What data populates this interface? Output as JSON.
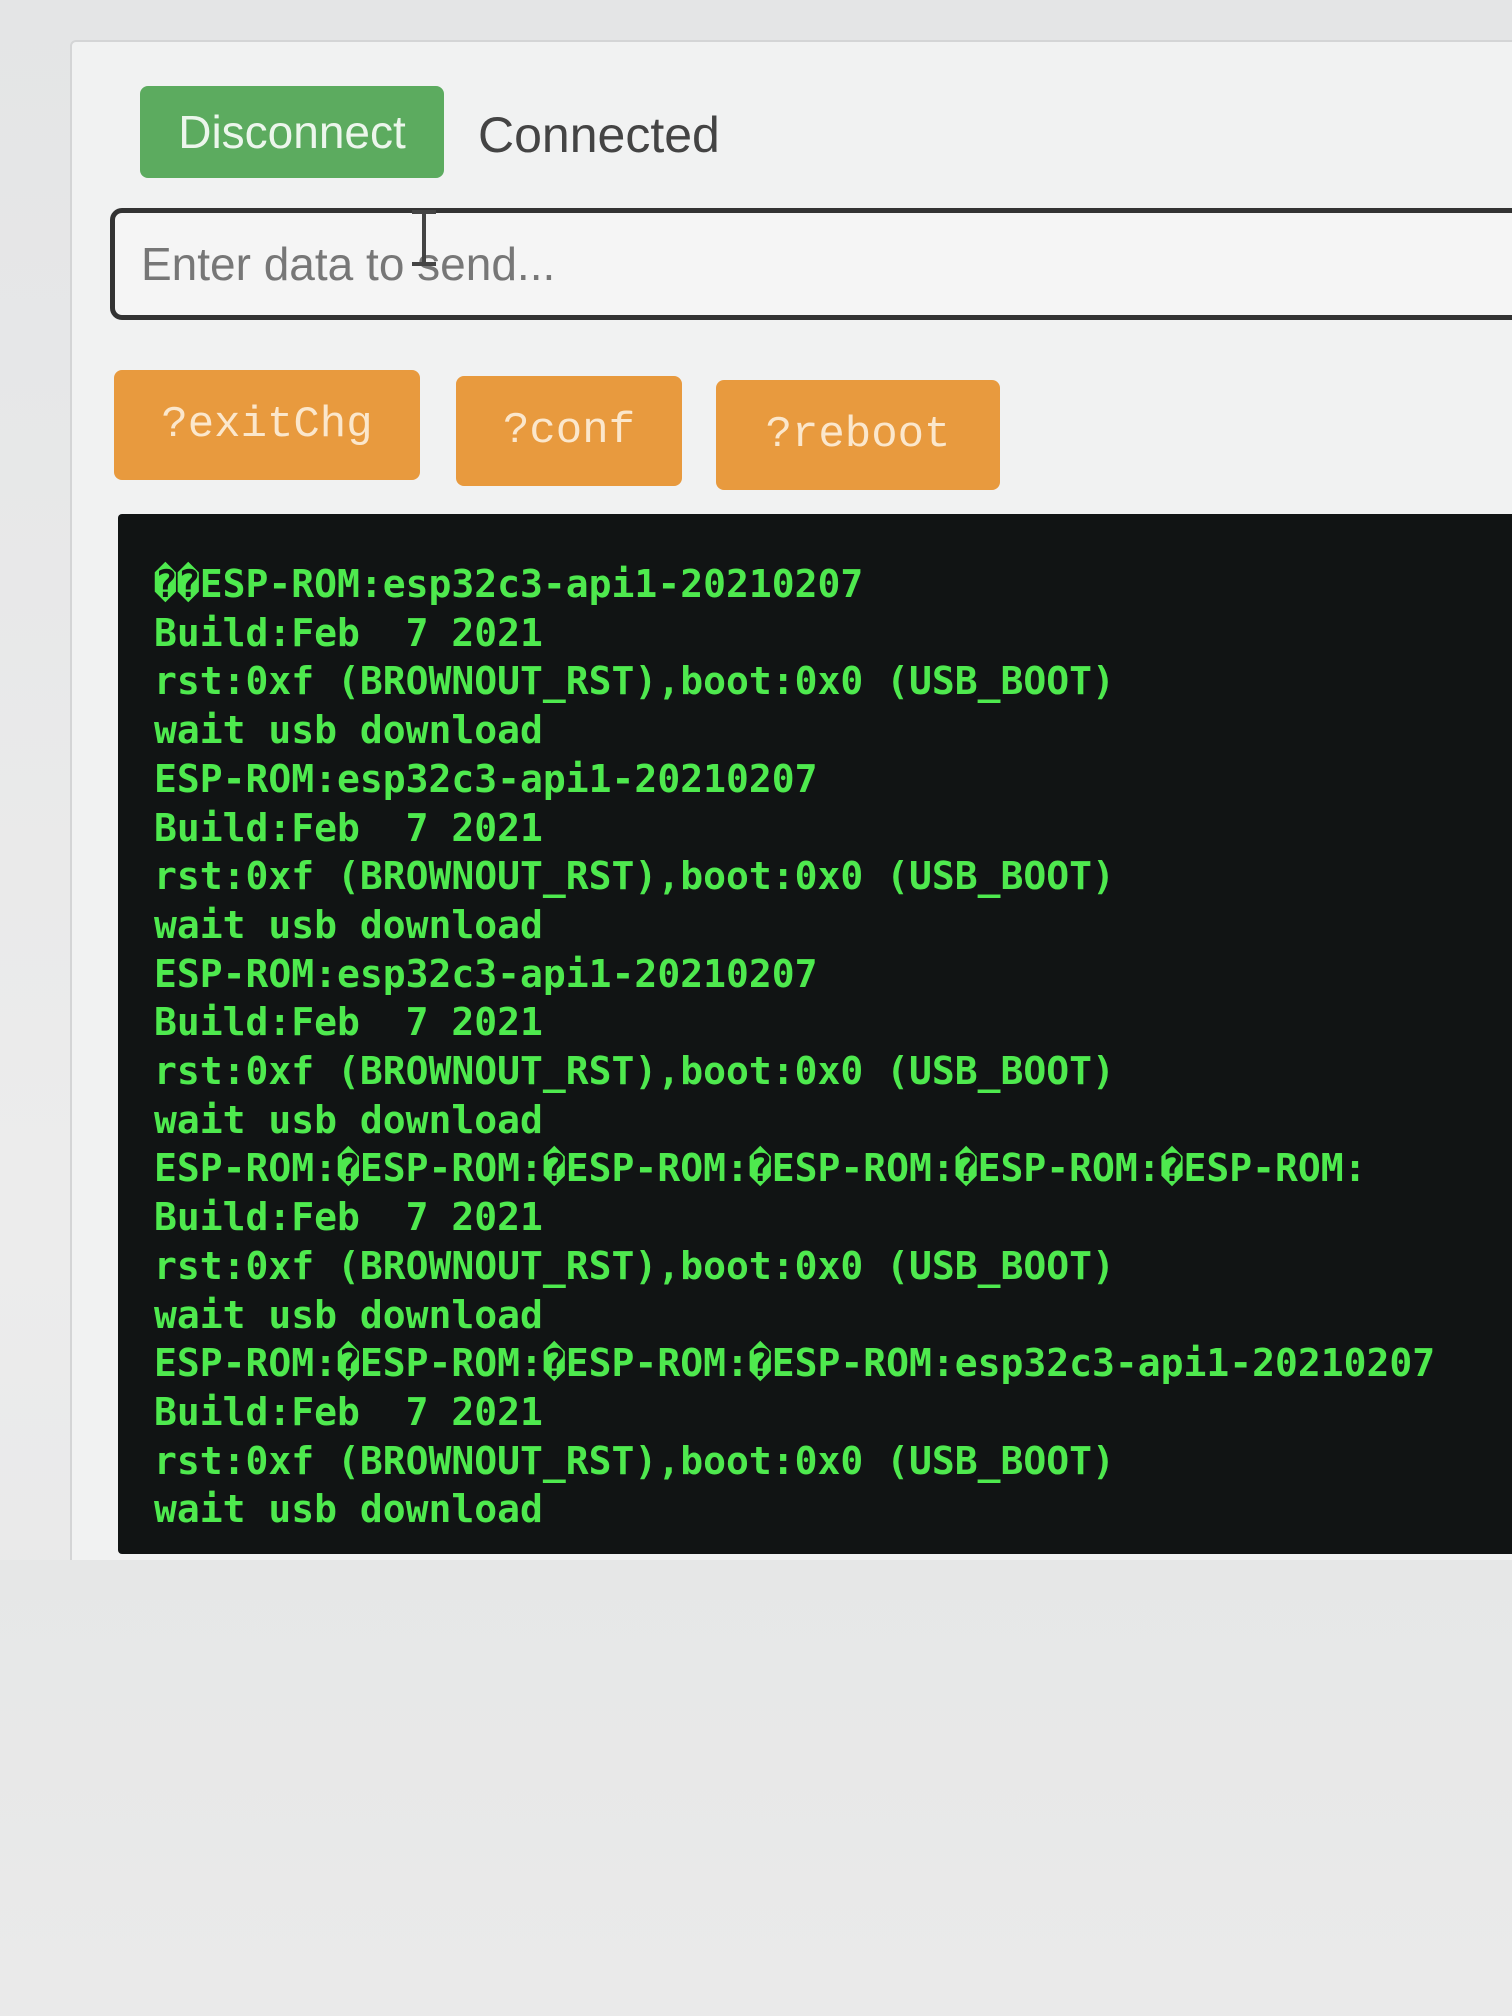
{
  "controls": {
    "disconnect_label": "Disconnect",
    "status": "Connected",
    "send_placeholder": "Enter data to send...",
    "send_value": ""
  },
  "commands": [
    {
      "label": "?exitChg"
    },
    {
      "label": "?conf"
    },
    {
      "label": "?reboot"
    }
  ],
  "console": {
    "text_color": "#4ee94e",
    "background": "#111414",
    "lines": [
      "��ESP-ROM:esp32c3-api1-20210207",
      "Build:Feb  7 2021",
      "rst:0xf (BROWNOUT_RST),boot:0x0 (USB_BOOT)",
      "wait usb download",
      "ESP-ROM:esp32c3-api1-20210207",
      "Build:Feb  7 2021",
      "rst:0xf (BROWNOUT_RST),boot:0x0 (USB_BOOT)",
      "wait usb download",
      "ESP-ROM:esp32c3-api1-20210207",
      "Build:Feb  7 2021",
      "rst:0xf (BROWNOUT_RST),boot:0x0 (USB_BOOT)",
      "wait usb download",
      "ESP-ROM:�ESP-ROM:�ESP-ROM:�ESP-ROM:�ESP-ROM:�ESP-ROM:",
      "Build:Feb  7 2021",
      "rst:0xf (BROWNOUT_RST),boot:0x0 (USB_BOOT)",
      "wait usb download",
      "ESP-ROM:�ESP-ROM:�ESP-ROM:�ESP-ROM:esp32c3-api1-20210207",
      "Build:Feb  7 2021",
      "rst:0xf (BROWNOUT_RST),boot:0x0 (USB_BOOT)",
      "wait usb download"
    ]
  },
  "colors": {
    "disconnect_button": "#5cab5f",
    "command_button": "#e89a3e"
  }
}
